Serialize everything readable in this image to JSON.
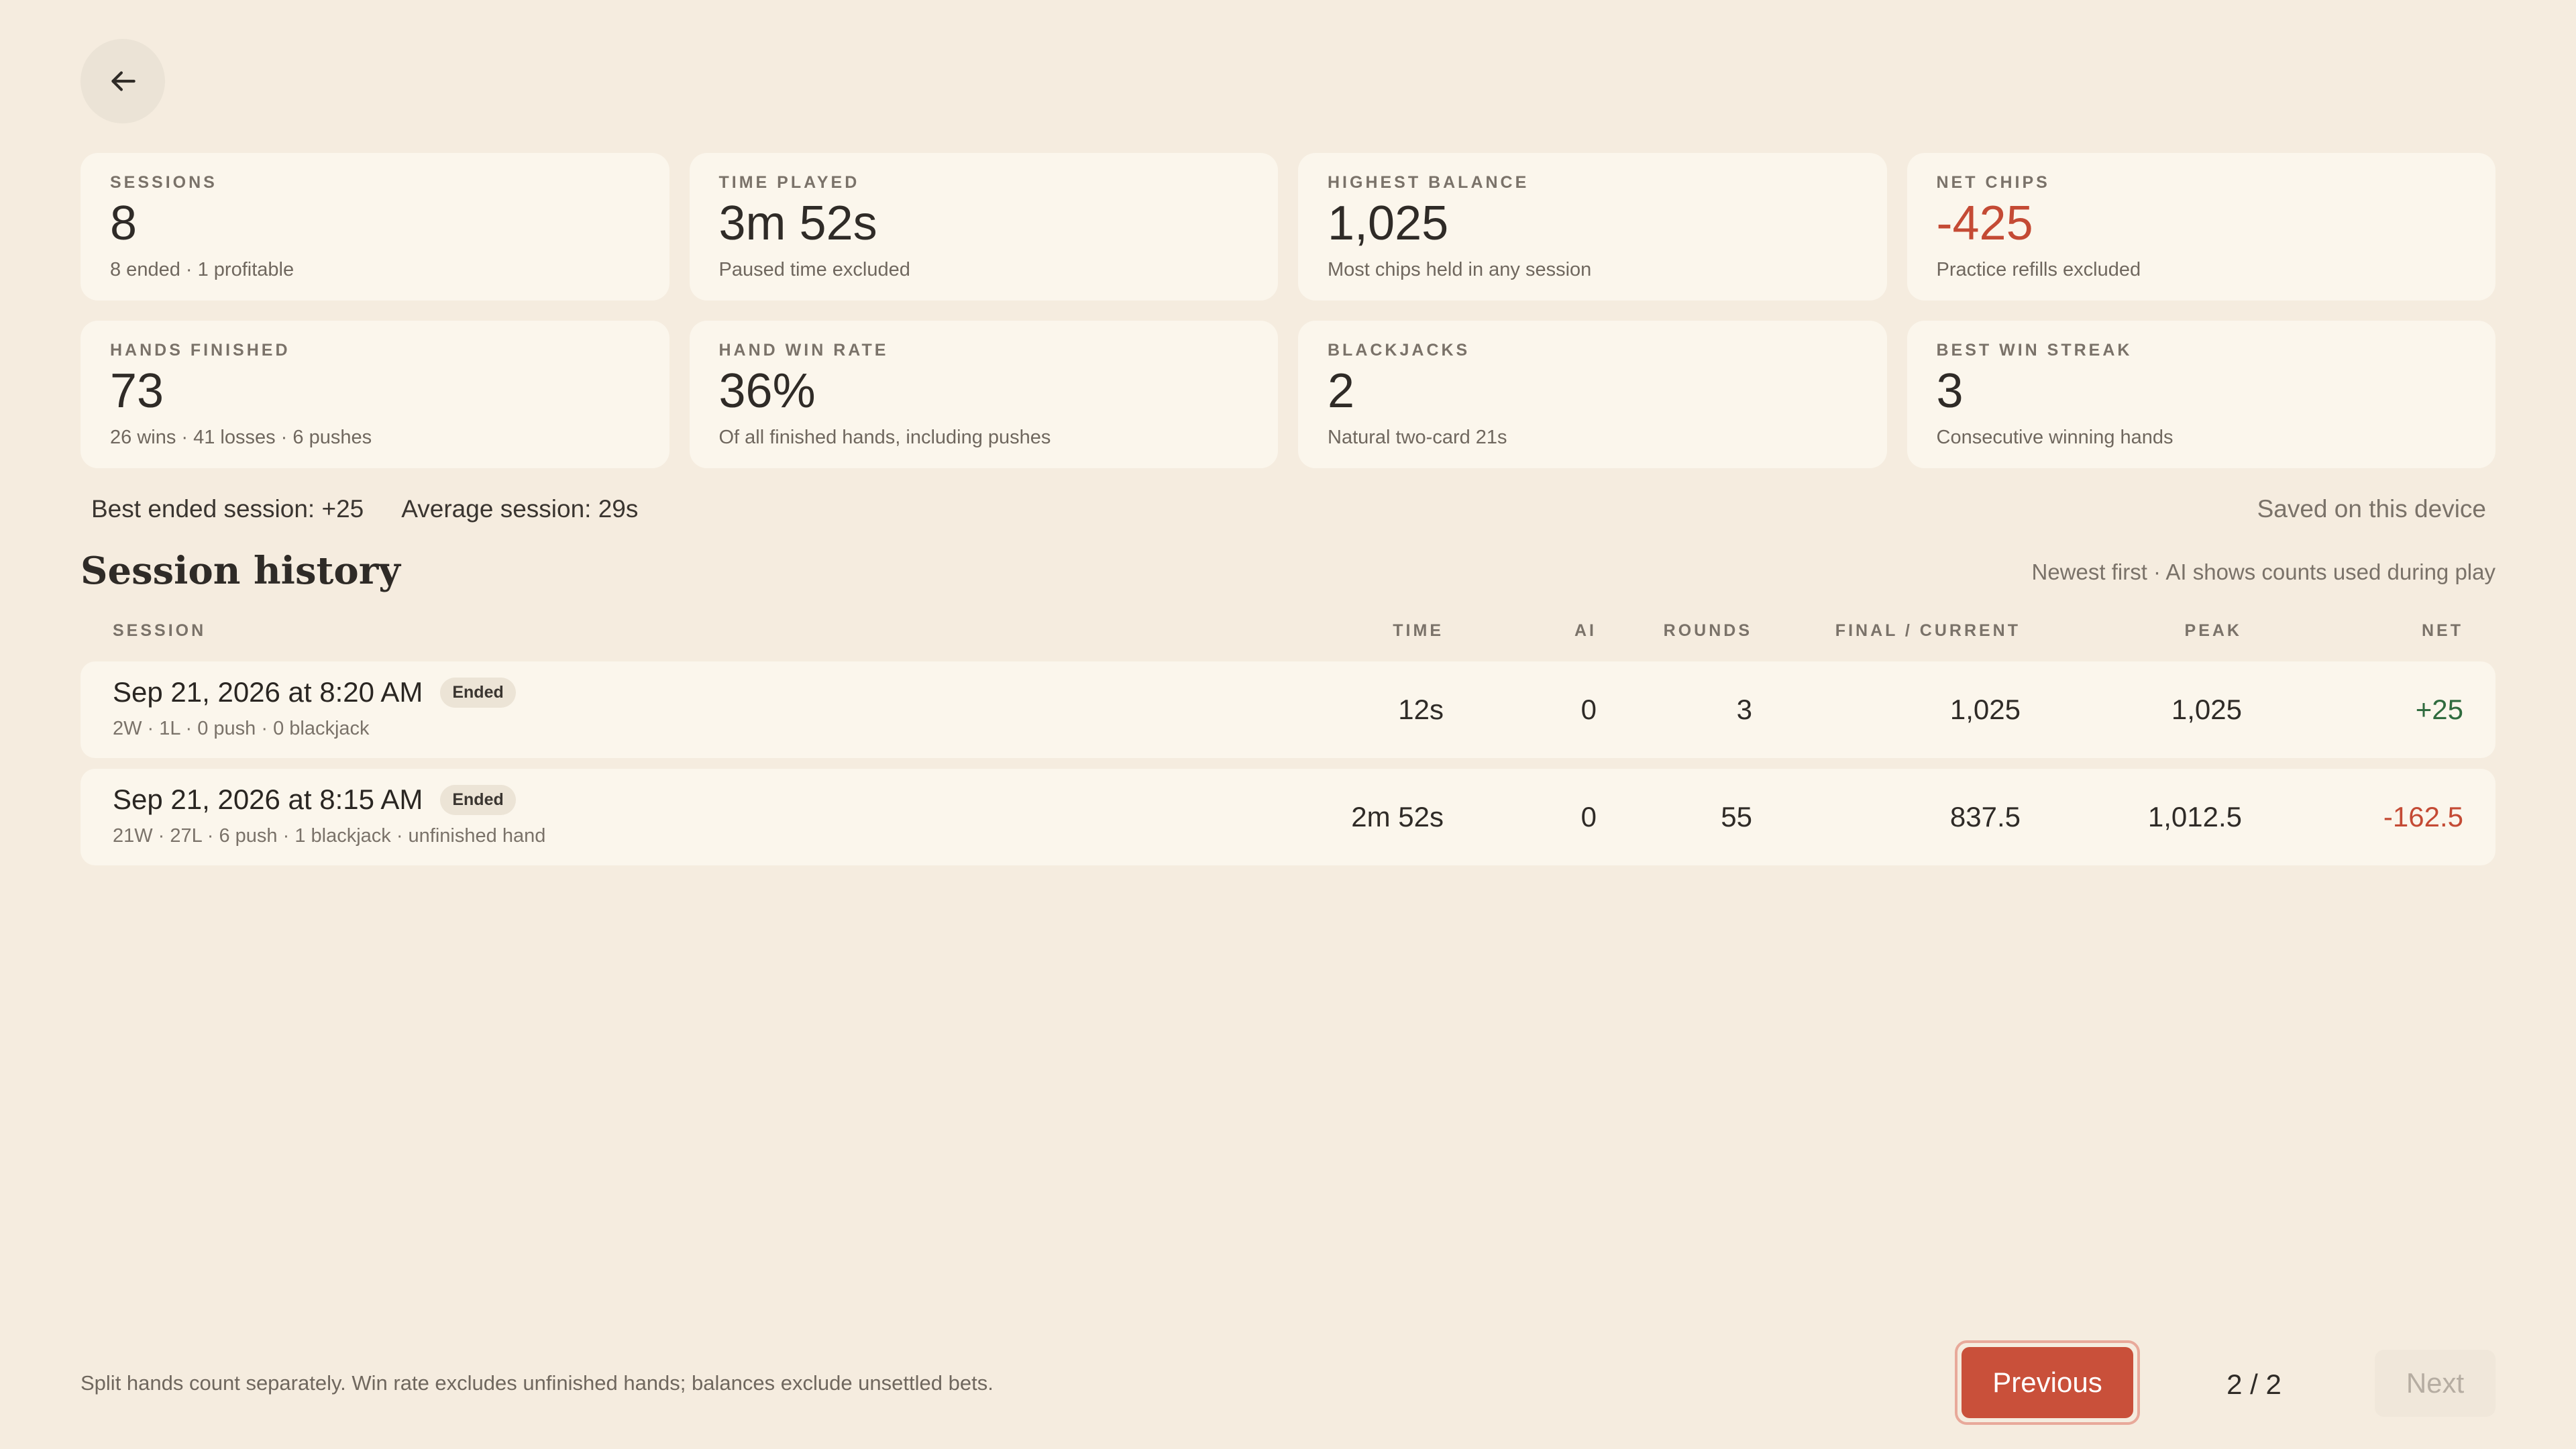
{
  "back_icon": "arrow-left-icon",
  "stats": [
    {
      "label": "SESSIONS",
      "value": "8",
      "sub": "8 ended · 1 profitable",
      "negative": false
    },
    {
      "label": "TIME PLAYED",
      "value": "3m 52s",
      "sub": "Paused time excluded",
      "negative": false
    },
    {
      "label": "HIGHEST BALANCE",
      "value": "1,025",
      "sub": "Most chips held in any session",
      "negative": false
    },
    {
      "label": "NET CHIPS",
      "value": "-425",
      "sub": "Practice refills excluded",
      "negative": true
    },
    {
      "label": "HANDS FINISHED",
      "value": "73",
      "sub": "26 wins · 41 losses · 6 pushes",
      "negative": false
    },
    {
      "label": "HAND WIN RATE",
      "value": "36%",
      "sub": "Of all finished hands, including pushes",
      "negative": false
    },
    {
      "label": "BLACKJACKS",
      "value": "2",
      "sub": "Natural two-card 21s",
      "negative": false
    },
    {
      "label": "BEST WIN STREAK",
      "value": "3",
      "sub": "Consecutive winning hands",
      "negative": false
    }
  ],
  "summary": {
    "best_session": "Best ended session: +25",
    "average_session": "Average session: 29s",
    "saved": "Saved on this device"
  },
  "history": {
    "title": "Session history",
    "note": "Newest first · AI shows counts used during play",
    "columns": {
      "session": "SESSION",
      "time": "TIME",
      "ai": "AI",
      "rounds": "ROUNDS",
      "final": "FINAL / CURRENT",
      "peak": "PEAK",
      "net": "NET"
    },
    "rows": [
      {
        "title": "Sep 21, 2026 at 8:20 AM",
        "badge": "Ended",
        "sub": "2W · 1L · 0 push · 0 blackjack",
        "time": "12s",
        "ai": "0",
        "rounds": "3",
        "final": "1,025",
        "peak": "1,025",
        "net": "+25"
      },
      {
        "title": "Sep 21, 2026 at 8:15 AM",
        "badge": "Ended",
        "sub": "21W · 27L · 6 push · 1 blackjack · unfinished hand",
        "time": "2m 52s",
        "ai": "0",
        "rounds": "55",
        "final": "837.5",
        "peak": "1,012.5",
        "net": "-162.5"
      }
    ]
  },
  "footer": {
    "note": "Split hands count separately. Win rate excludes unfinished hands; balances exclude unsettled bets.",
    "previous": "Previous",
    "page": "2 / 2",
    "next": "Next"
  },
  "colors": {
    "background": "#f5ecdf",
    "card": "#fbf6ec",
    "accent": "#c9503a",
    "negative": "#c44a34",
    "positive": "#2f6b3e"
  }
}
